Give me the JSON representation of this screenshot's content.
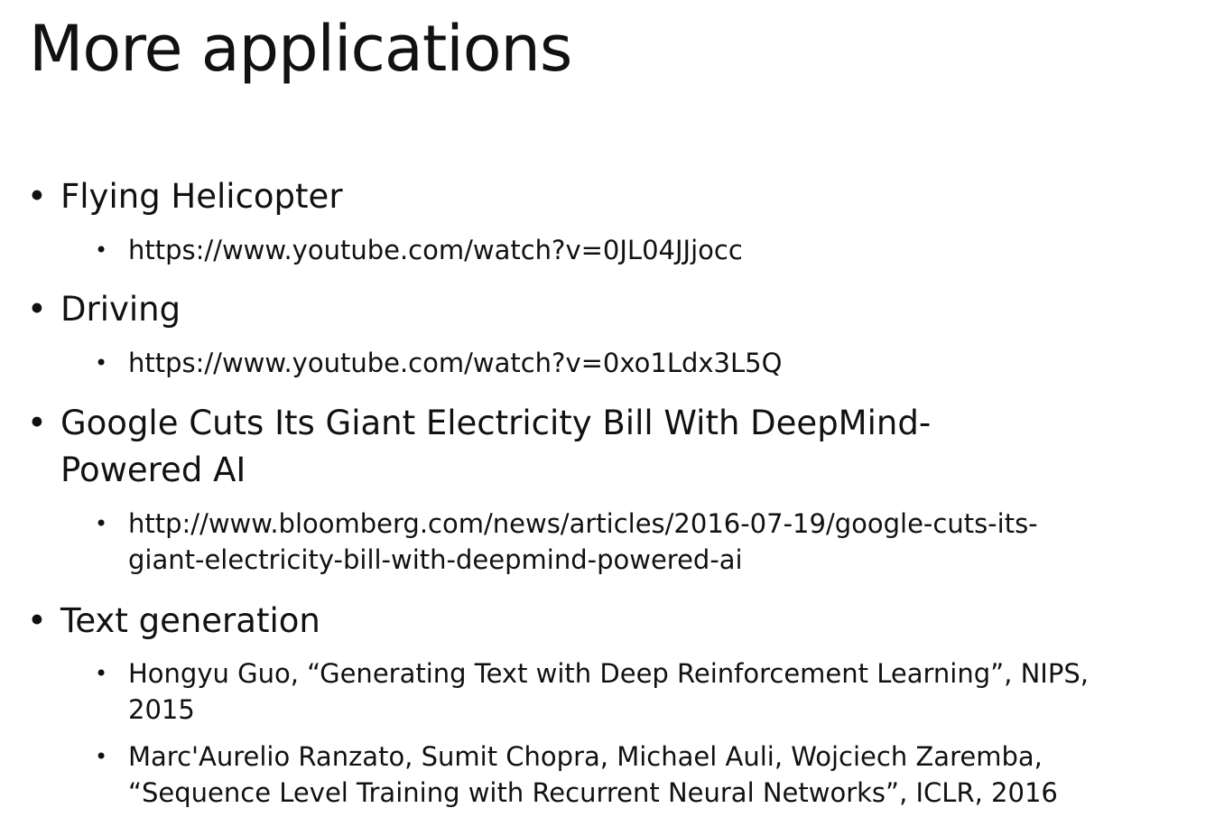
{
  "slide": {
    "title": "More applications",
    "items": [
      {
        "bullet": "•",
        "line1": "Flying Helicopter",
        "subs": [
          {
            "bullet": "•",
            "line1": "https://www.youtube.com/watch?v=0JL04JJjocc"
          }
        ]
      },
      {
        "bullet": "•",
        "line1": "Driving",
        "subs": [
          {
            "bullet": "•",
            "line1": "https://www.youtube.com/watch?v=0xo1Ldx3L5Q"
          }
        ]
      },
      {
        "bullet": "•",
        "line1": "Google Cuts Its Giant Electricity Bill With DeepMind-",
        "line2": "Powered AI",
        "subs": [
          {
            "bullet": "•",
            "line1": "http://www.bloomberg.com/news/articles/2016-07-19/google-cuts-its-",
            "line2": "giant-electricity-bill-with-deepmind-powered-ai"
          }
        ]
      },
      {
        "bullet": "•",
        "line1": "Text generation",
        "subs": [
          {
            "bullet": "•",
            "line1": "Hongyu Guo, “Generating Text with Deep Reinforcement Learning”, NIPS,",
            "line2": "2015"
          },
          {
            "bullet": "•",
            "line1": "Marc'Aurelio Ranzato, Sumit Chopra, Michael Auli, Wojciech Zaremba,",
            "line2": "“Sequence Level Training with Recurrent Neural Networks”, ICLR, 2016"
          }
        ]
      }
    ]
  }
}
